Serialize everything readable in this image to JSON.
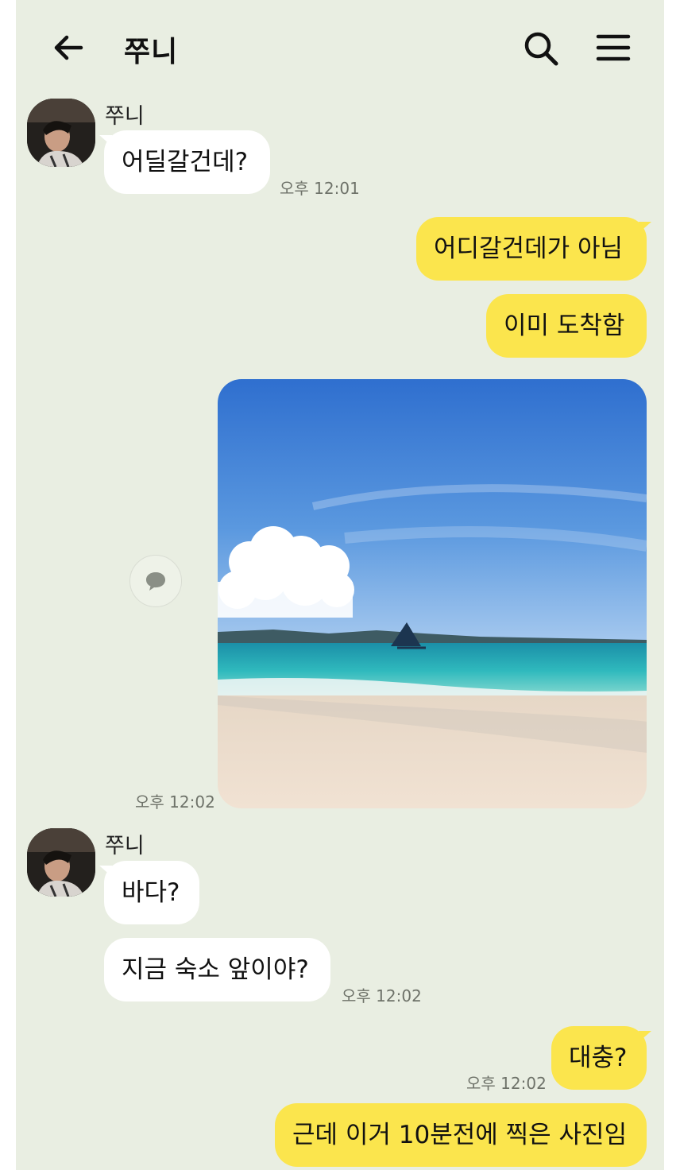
{
  "header": {
    "back_icon": "arrow-left-icon",
    "title": "쭈니",
    "search_icon": "search-icon",
    "menu_icon": "hamburger-menu-icon"
  },
  "messages": {
    "g1": {
      "sender": "쭈니",
      "text1": "어딜갈건데?",
      "time": "오후 12:01"
    },
    "out1": {
      "text": "어디갈건데가 아님"
    },
    "out2": {
      "text": "이미 도착함"
    },
    "photo": {
      "time": "오후 12:02",
      "share_icon": "speech-bubble-icon"
    },
    "g2": {
      "sender": "쭈니",
      "text1": "바다?",
      "text2": "지금 숙소 앞이야?",
      "time": "오후 12:02"
    },
    "out3": {
      "text": "대충?",
      "time": "오후 12:02"
    },
    "out4": {
      "text": "근데 이거 10분전에 찍은 사진임"
    }
  },
  "colors": {
    "background": "#e9eee2",
    "outgoing_bubble": "#fbe54d",
    "incoming_bubble": "#ffffff"
  }
}
